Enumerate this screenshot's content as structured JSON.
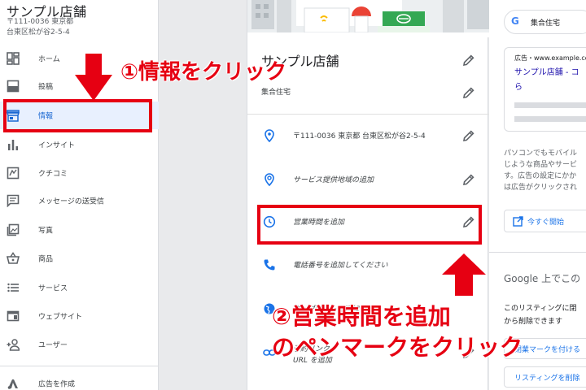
{
  "sidebar": {
    "business_name": "サンプル店舗",
    "address_line1": "〒111-0036 東京都",
    "address_line2": "台東区松が谷2-5-4",
    "items": [
      {
        "label": "ホーム",
        "icon": "dashboard-icon"
      },
      {
        "label": "投稿",
        "icon": "post-icon"
      },
      {
        "label": "情報",
        "icon": "store-icon",
        "active": true
      },
      {
        "label": "インサイト",
        "icon": "bar-chart-icon"
      },
      {
        "label": "クチコミ",
        "icon": "review-icon"
      },
      {
        "label": "メッセージの送受信",
        "icon": "message-icon"
      },
      {
        "label": "写真",
        "icon": "photo-icon"
      },
      {
        "label": "商品",
        "icon": "basket-icon"
      },
      {
        "label": "サービス",
        "icon": "list-icon"
      },
      {
        "label": "ウェブサイト",
        "icon": "website-icon"
      },
      {
        "label": "ユーザー",
        "icon": "add-user-icon"
      },
      {
        "label": "広告を作成",
        "icon": "ads-icon"
      }
    ]
  },
  "card": {
    "title": "サンプル店舗",
    "category": "集合住宅",
    "rows": [
      {
        "label": "〒111-0036 東京都 台東区松が谷2-5-4",
        "icon": "location-pin-icon"
      },
      {
        "label": "サービス提供地域の追加",
        "icon": "service-area-icon"
      },
      {
        "label": "営業時間を追加",
        "icon": "clock-icon"
      },
      {
        "label": "電話番号を追加してください",
        "icon": "phone-icon"
      },
      {
        "label": "ウェブサイトを追加",
        "icon": "globe-icon"
      },
      {
        "label": "予約リンク",
        "sub": "URL を追加",
        "icon": "link-icon"
      }
    ]
  },
  "right": {
    "search_text": "集合住宅",
    "ad_line": "広告・www.example.com",
    "ad_link_line1": "サンプル店舗 - コ",
    "ad_link_line2": "ら",
    "description_lines": [
      "パソコンでもモバイル",
      "じような商品やサービ",
      "す。広告の設定にかか",
      "は広告がクリックされ"
    ],
    "start_button": "今すぐ開始",
    "google_heading": "Google 上でこの",
    "listing_lines": [
      "このリスティングに閉",
      "から削除できます"
    ],
    "btn_close_business": "閉業マークを付ける",
    "btn_delete_listing": "リスティングを削除"
  },
  "annotations": {
    "step1": "①情報をクリック",
    "step2_line1": "②営業時間を追加",
    "step2_line2": "のペンマークをクリック"
  },
  "colors": {
    "accent_red": "#e60012",
    "active_blue": "#1967d2",
    "active_bg": "#e8f0fe",
    "icon_gray": "#5f6368",
    "link_blue": "#1a73e8"
  }
}
